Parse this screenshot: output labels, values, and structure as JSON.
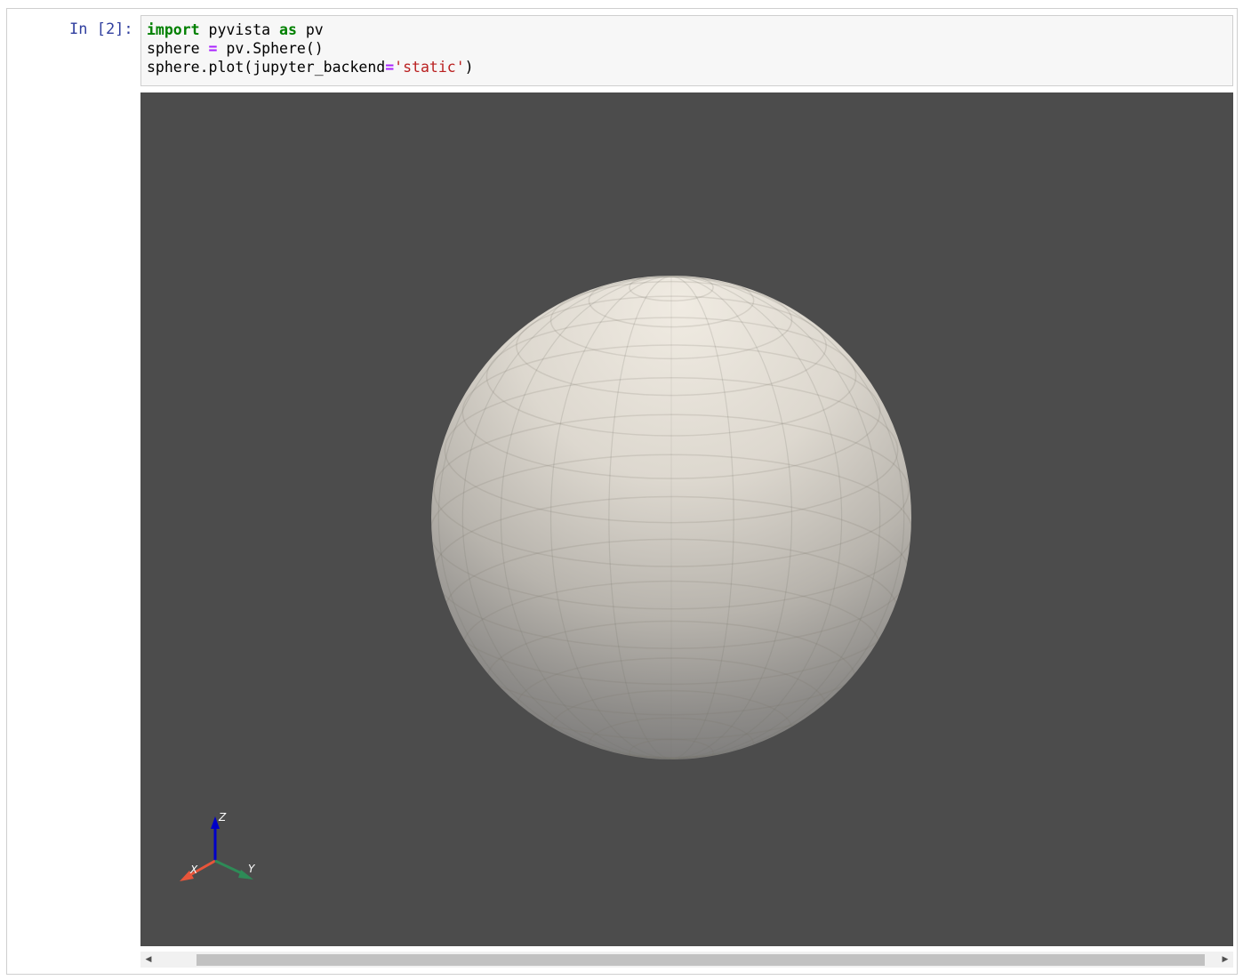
{
  "cell": {
    "prompt": "In [2]:",
    "code_lines": [
      [
        {
          "t": "import",
          "c": "kw"
        },
        {
          "t": " pyvista ",
          "c": ""
        },
        {
          "t": "as",
          "c": "kw"
        },
        {
          "t": " pv",
          "c": ""
        }
      ],
      [
        {
          "t": "sphere ",
          "c": ""
        },
        {
          "t": "=",
          "c": "op"
        },
        {
          "t": " pv.Sphere()",
          "c": ""
        }
      ],
      [
        {
          "t": "sphere.plot(jupyter_backend",
          "c": ""
        },
        {
          "t": "=",
          "c": "op"
        },
        {
          "t": "'static'",
          "c": "str"
        },
        {
          "t": ")",
          "c": ""
        }
      ]
    ]
  },
  "output": {
    "background_color": "#4c4c4c",
    "mesh_color": "#e9e4dc",
    "axes": {
      "x_label": "X",
      "y_label": "Y",
      "z_label": "Z",
      "x_color": "#e8553a",
      "y_color": "#2e8b57",
      "z_color": "#0000c8"
    }
  },
  "scrollbar": {
    "left_arrow": "◀",
    "right_arrow": "▶"
  }
}
